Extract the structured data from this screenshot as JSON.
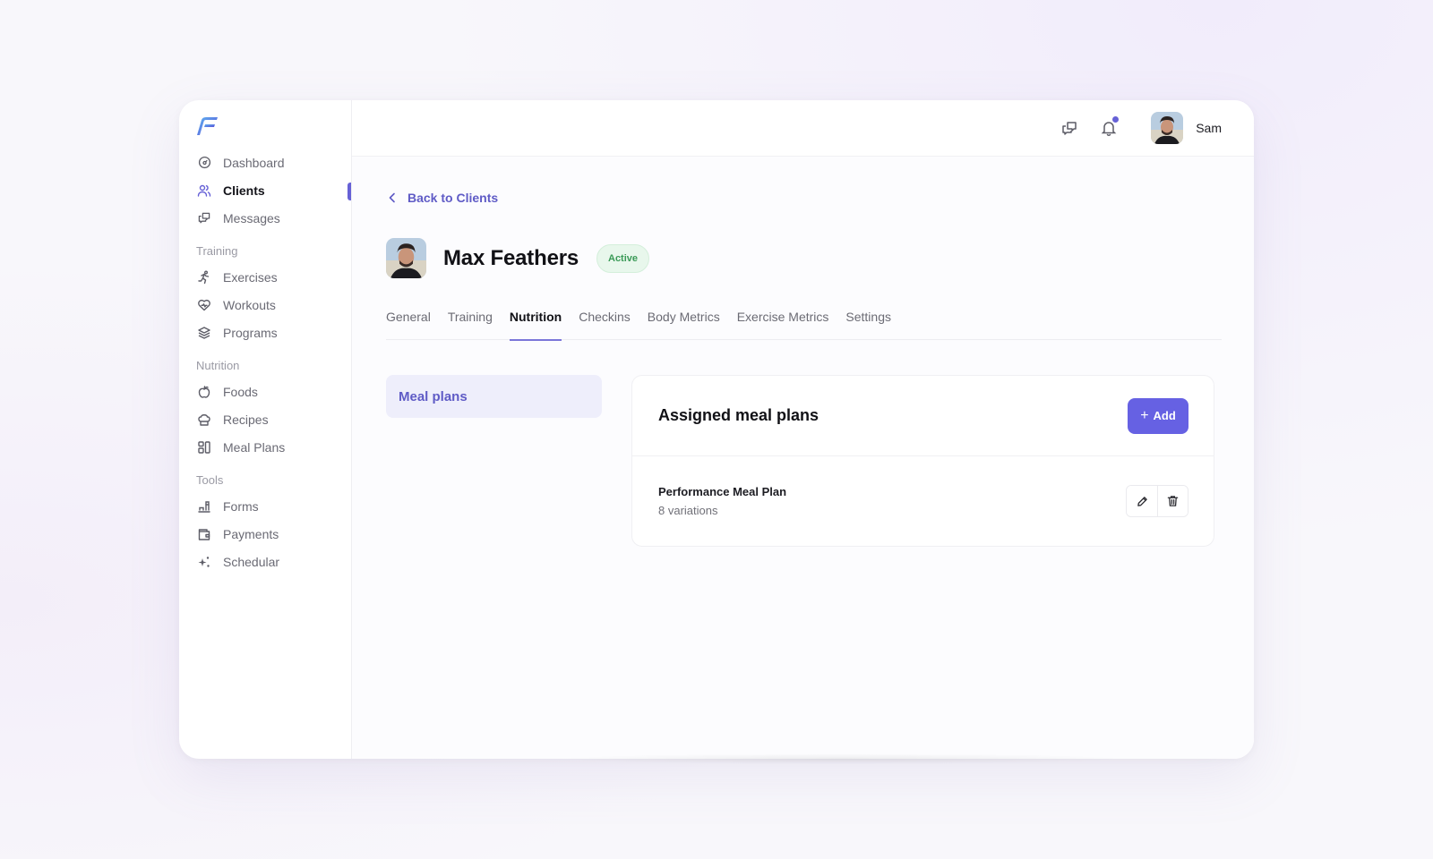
{
  "brand": {
    "logo_name": "fitness-app-logo",
    "accent": "#6661e3"
  },
  "sidebar": {
    "main_items": [
      {
        "label": "Dashboard",
        "icon": "gauge-icon"
      },
      {
        "label": "Clients",
        "icon": "users-icon",
        "active": true
      },
      {
        "label": "Messages",
        "icon": "chat-icon"
      }
    ],
    "sections": [
      {
        "title": "Training",
        "items": [
          {
            "label": "Exercises",
            "icon": "running-icon"
          },
          {
            "label": "Workouts",
            "icon": "heart-pulse-icon"
          },
          {
            "label": "Programs",
            "icon": "layers-icon"
          }
        ]
      },
      {
        "title": "Nutrition",
        "items": [
          {
            "label": "Foods",
            "icon": "apple-icon"
          },
          {
            "label": "Recipes",
            "icon": "chef-hat-icon"
          },
          {
            "label": "Meal Plans",
            "icon": "grid-icon"
          }
        ]
      },
      {
        "title": "Tools",
        "items": [
          {
            "label": "Forms",
            "icon": "forms-icon"
          },
          {
            "label": "Payments",
            "icon": "wallet-icon"
          },
          {
            "label": "Schedular",
            "icon": "sparkles-icon"
          }
        ]
      }
    ]
  },
  "topbar": {
    "user_name": "Sam",
    "has_notification": true
  },
  "page": {
    "back_label": "Back to Clients",
    "client_name": "Max Feathers",
    "status": "Active",
    "tabs": [
      "General",
      "Training",
      "Nutrition",
      "Checkins",
      "Body Metrics",
      "Exercise Metrics",
      "Settings"
    ],
    "active_tab": "Nutrition",
    "submenu": [
      "Meal plans"
    ]
  },
  "card": {
    "title": "Assigned meal plans",
    "add_label": "Add",
    "plans": [
      {
        "name": "Performance Meal Plan",
        "subtitle": "8 variations"
      }
    ]
  }
}
